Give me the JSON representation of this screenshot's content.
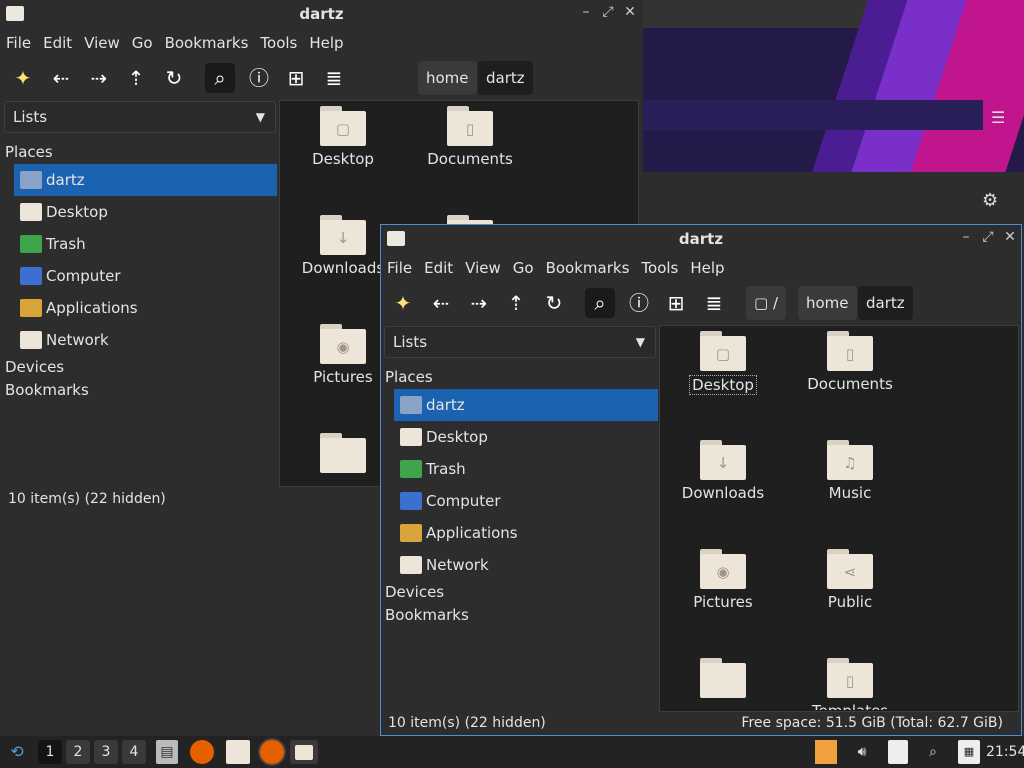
{
  "desktop": {
    "menu_icon": "hamburger-icon",
    "gear_icon": "gear-icon"
  },
  "back_window": {
    "title": "dartz",
    "menu": [
      "File",
      "Edit",
      "View",
      "Go",
      "Bookmarks",
      "Tools",
      "Help"
    ],
    "path": {
      "root": "/",
      "crumbs": [
        "home",
        "dartz"
      ]
    },
    "sidebar_mode": "Lists",
    "places_header": "Places",
    "places": [
      {
        "label": "dartz",
        "icon": "home-folder-icon",
        "selected": true
      },
      {
        "label": "Desktop",
        "icon": "desktop-folder-icon"
      },
      {
        "label": "Trash",
        "icon": "trash-icon"
      },
      {
        "label": "Computer",
        "icon": "computer-icon"
      },
      {
        "label": "Applications",
        "icon": "applications-icon"
      },
      {
        "label": "Network",
        "icon": "network-folder-icon"
      }
    ],
    "devices_header": "Devices",
    "bookmarks_header": "Bookmarks",
    "files": [
      {
        "name": "Desktop",
        "glyph": "▢"
      },
      {
        "name": "Documents",
        "glyph": "▯"
      },
      {
        "name": "Downloads",
        "glyph": "↓"
      },
      {
        "name": "",
        "glyph": ""
      },
      {
        "name": "Pictures",
        "glyph": "◉"
      },
      {
        "name": "",
        "glyph": ""
      }
    ],
    "status": "10 item(s) (22 hidden)"
  },
  "front_window": {
    "title": "dartz",
    "menu": [
      "File",
      "Edit",
      "View",
      "Go",
      "Bookmarks",
      "Tools",
      "Help"
    ],
    "path": {
      "root": "/",
      "crumbs": [
        "home",
        "dartz"
      ]
    },
    "sidebar_mode": "Lists",
    "places_header": "Places",
    "places": [
      {
        "label": "dartz",
        "icon": "home-folder-icon",
        "selected": true
      },
      {
        "label": "Desktop",
        "icon": "desktop-folder-icon"
      },
      {
        "label": "Trash",
        "icon": "trash-icon"
      },
      {
        "label": "Computer",
        "icon": "computer-icon"
      },
      {
        "label": "Applications",
        "icon": "applications-icon"
      },
      {
        "label": "Network",
        "icon": "network-folder-icon"
      }
    ],
    "devices_header": "Devices",
    "bookmarks_header": "Bookmarks",
    "files": [
      {
        "name": "Desktop",
        "glyph": "▢"
      },
      {
        "name": "Documents",
        "glyph": "▯"
      },
      {
        "name": "Downloads",
        "glyph": "↓"
      },
      {
        "name": "Music",
        "glyph": "♫"
      },
      {
        "name": "Pictures",
        "glyph": "◉"
      },
      {
        "name": "Public",
        "glyph": "⋖"
      },
      {
        "name": "",
        "glyph": ""
      },
      {
        "name": "Templates",
        "glyph": "▯"
      }
    ],
    "status_left": "10 item(s) (22 hidden)",
    "status_right": "Free space: 51.5 GiB (Total: 62.7 GiB)"
  },
  "taskbar": {
    "workspaces": [
      "1",
      "2",
      "3",
      "4"
    ],
    "clock": "21:54"
  }
}
